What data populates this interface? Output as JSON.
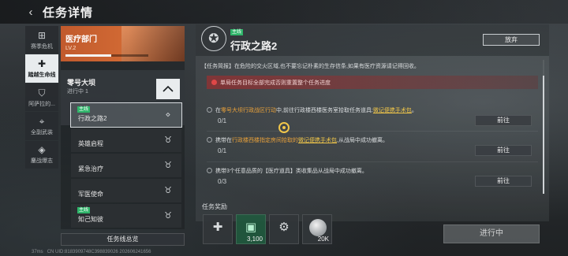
{
  "header": {
    "title": "任务详情",
    "back_glyph": "‹"
  },
  "rail": {
    "items": [
      {
        "label": "赛季危机",
        "icon": "season-icon",
        "glyph": "⊞",
        "active": false
      },
      {
        "label": "踏越生命线",
        "icon": "plus-icon",
        "glyph": "✚",
        "active": true
      },
      {
        "label": "阿萨拉的...",
        "icon": "shield-icon",
        "glyph": "⛉",
        "active": false
      },
      {
        "label": "全副武装",
        "icon": "gun-icon",
        "glyph": "⌖",
        "active": false
      },
      {
        "label": "鏖战爆志",
        "icon": "diamond-icon",
        "glyph": "◈",
        "active": false
      }
    ]
  },
  "department": {
    "name": "医疗部门",
    "level": "LV.2",
    "progress": 0.55
  },
  "group": {
    "name": "零号大坝",
    "status": "进行中 1"
  },
  "quests": [
    {
      "tag": "主线",
      "name": "行政之路2",
      "icon_glyph": "⋄",
      "selected": true
    },
    {
      "tag": "",
      "name": "英雄启程",
      "icon_glyph": "♉",
      "selected": false
    },
    {
      "tag": "",
      "name": "紧急治疗",
      "icon_glyph": "♉",
      "selected": false
    },
    {
      "tag": "",
      "name": "军医使命",
      "icon_glyph": "♉",
      "selected": false
    },
    {
      "tag": "主线",
      "name": "知己知彼",
      "icon_glyph": "♉",
      "selected": false
    }
  ],
  "overview_label": "任务线总览",
  "detail": {
    "tag": "主线",
    "title": "行政之路2",
    "abandon_label": "放弃",
    "brief": "【任务简报】在危险的交火区域,也不要忘记朴素的生存信条,如果有医疗资源请记得回收。",
    "warning": "单局任务目标全部完成否则重置整个任务进度",
    "tasks": [
      {
        "pre": "在",
        "hl1": "零号大坝行政战区行动",
        "mid": "中,前往行政楼西楼医务室拾取任务道具:",
        "hl2": "微记便携手术包",
        "post": "。",
        "progress": "0/1",
        "action": "前往"
      },
      {
        "pre": "携带在",
        "hl1": "行政楼西楼指定房间拾取的",
        "mid": "",
        "hl2": "微记便携手术包",
        "post": ",从战局中成功撤离。",
        "progress": "0/1",
        "action": "前往"
      },
      {
        "pre": "携带3个任意品质的【医疗道具】类收集品从战局中成功撤离。",
        "hl1": "",
        "mid": "",
        "hl2": "",
        "post": "",
        "progress": "0/3",
        "action": "前往"
      }
    ]
  },
  "rewards": {
    "label": "任务奖励",
    "items": [
      {
        "icon": "medkit-icon",
        "glyph": "✚",
        "qty": ""
      },
      {
        "icon": "token-icon",
        "glyph": "▣",
        "qty": "3,100"
      },
      {
        "icon": "gear-item-icon",
        "glyph": "⚙",
        "qty": ""
      },
      {
        "icon": "coin-icon",
        "glyph": "",
        "qty": "20K"
      }
    ]
  },
  "progress_button": "进行中",
  "status": {
    "ms": "37ms",
    "uid": "CN UID:8183909748C398839026 202606241656"
  }
}
